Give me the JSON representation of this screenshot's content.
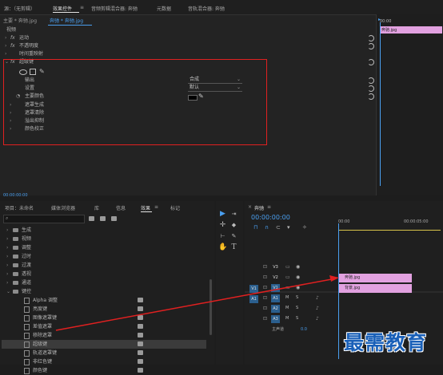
{
  "source_monitor": {
    "tabs": [
      "源：（无剪辑）",
      "效果控件",
      "音频剪辑混合器: 奔驰",
      "元数据",
      "音轨混合器: 奔驰"
    ],
    "active_index": 1,
    "menu_icon": "hamburger-icon"
  },
  "effect_controls": {
    "master_label": "主要 * 奔驰.jpg",
    "sequence_label": "奔驰 * 奔驰.jpg",
    "section_header": "视频",
    "effects": [
      {
        "name": "运动",
        "fx": "fx"
      },
      {
        "name": "不透明度",
        "fx": "fx"
      },
      {
        "name": "时间重映射",
        "fx": ""
      },
      {
        "name": "超级键",
        "fx": "fx"
      }
    ],
    "ultra_key": {
      "output_label": "输出",
      "output_value": "合成",
      "setting_label": "设置",
      "setting_value": "默认",
      "key_color_label": "主要颜色",
      "key_color": "#000000",
      "subgroups": [
        "遮罩生成",
        "遮罩清除",
        "溢出抑制",
        "颜色校正"
      ]
    },
    "timecode": "00:00:00:00",
    "mini_timeline": {
      "time": "00:00",
      "clip": "奔驰.jpg"
    }
  },
  "project_panel": {
    "tabs": [
      "项目：未命名",
      "媒体浏览器",
      "库",
      "信息",
      "效果",
      "标记"
    ],
    "active_index": 4,
    "search_placeholder": "",
    "tree": [
      {
        "label": "生成",
        "type": "folder",
        "indent": 1
      },
      {
        "label": "视频",
        "type": "folder",
        "indent": 1
      },
      {
        "label": "调整",
        "type": "folder",
        "indent": 1
      },
      {
        "label": "过时",
        "type": "folder",
        "indent": 1
      },
      {
        "label": "过渡",
        "type": "folder",
        "indent": 1
      },
      {
        "label": "透视",
        "type": "folder",
        "indent": 1
      },
      {
        "label": "通道",
        "type": "folder",
        "indent": 1
      },
      {
        "label": "键控",
        "type": "folder",
        "indent": 1
      },
      {
        "label": "Alpha 调整",
        "type": "effect",
        "indent": 2
      },
      {
        "label": "亮度键",
        "type": "effect",
        "indent": 2
      },
      {
        "label": "图像遮罩键",
        "type": "effect",
        "indent": 2
      },
      {
        "label": "差值遮罩",
        "type": "effect",
        "indent": 2
      },
      {
        "label": "移除遮罩",
        "type": "effect",
        "indent": 2
      },
      {
        "label": "超级键",
        "type": "effect",
        "indent": 2
      },
      {
        "label": "轨道遮罩键",
        "type": "effect",
        "indent": 2
      },
      {
        "label": "非红色键",
        "type": "effect",
        "indent": 2
      },
      {
        "label": "颜色键",
        "type": "effect",
        "indent": 2
      }
    ],
    "selected_label": "超级键"
  },
  "timeline": {
    "sequence_name": "奔驰",
    "timecode": "00:00:00:00",
    "ruler": [
      "00:00",
      "00:00:05:00"
    ],
    "video_tracks": [
      "V3",
      "V2",
      "V1"
    ],
    "audio_tracks": [
      "A1",
      "A2",
      "A3"
    ],
    "source_patch": [
      "V1",
      "A1"
    ],
    "clips": [
      {
        "label": "奔驰.jpg",
        "track": "V2"
      },
      {
        "label": "背景.jpg",
        "track": "V1"
      }
    ],
    "master_label": "主声道",
    "master_value": "0.0",
    "clip_color": "#e2a1e0"
  },
  "watermark": "最需教育",
  "accent": "#2d8ceb",
  "annotation_color": "#e02020"
}
